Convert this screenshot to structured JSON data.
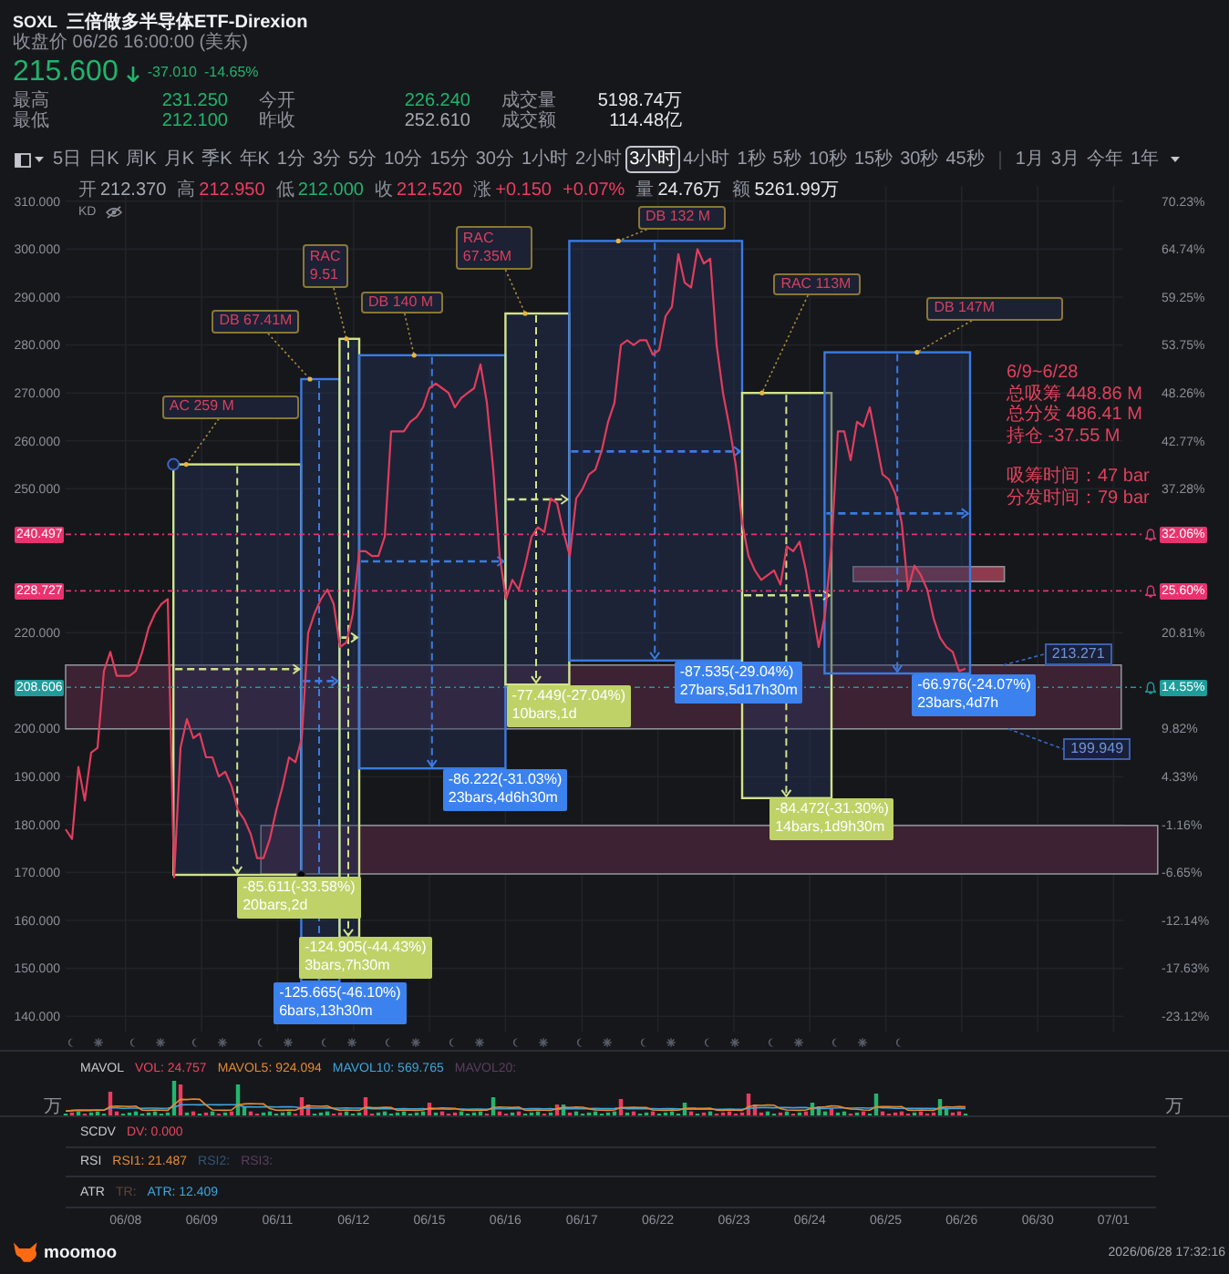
{
  "quote": {
    "symbol": "SOXL",
    "name": "三倍做多半导体ETF-Direxion",
    "close_time": "收盘价 06/26 16:00:00 (美东)",
    "price": "215.600",
    "change": "-37.010",
    "change_pct": "-14.65%",
    "falling": true
  },
  "stats": [
    {
      "label": "最高",
      "value": "231.250",
      "color": "#1fb46b"
    },
    {
      "label": "今开",
      "value": "226.240",
      "color": "#1fb46b"
    },
    {
      "label": "成交量",
      "value": "5198.74万",
      "color": "#e4e6ea"
    },
    {
      "label": "最低",
      "value": "212.100",
      "color": "#1fb46b"
    },
    {
      "label": "昨收",
      "value": "252.610",
      "color": "#a4a9b1"
    },
    {
      "label": "成交额",
      "value": "114.48亿",
      "color": "#e4e6ea"
    }
  ],
  "toolbar": {
    "periods": [
      {
        "label": "5日",
        "selected": false
      },
      {
        "label": "日K",
        "selected": false
      },
      {
        "label": "周K",
        "selected": false
      },
      {
        "label": "月K",
        "selected": false
      },
      {
        "label": "季K",
        "selected": false
      },
      {
        "label": "年K",
        "selected": false
      },
      {
        "label": "1分",
        "selected": false
      },
      {
        "label": "3分",
        "selected": false
      },
      {
        "label": "5分",
        "selected": false
      },
      {
        "label": "10分",
        "selected": false
      },
      {
        "label": "15分",
        "selected": false
      },
      {
        "label": "30分",
        "selected": false
      },
      {
        "label": "1小时",
        "selected": false
      },
      {
        "label": "2小时",
        "selected": false
      },
      {
        "label": "3小时",
        "selected": true
      },
      {
        "label": "4小时",
        "selected": false
      },
      {
        "label": "1秒",
        "selected": false
      },
      {
        "label": "5秒",
        "selected": false
      },
      {
        "label": "10秒",
        "selected": false
      },
      {
        "label": "15秒",
        "selected": false
      },
      {
        "label": "30秒",
        "selected": false
      },
      {
        "label": "45秒",
        "selected": false
      }
    ],
    "ranges": [
      {
        "label": "1月",
        "selected": false
      },
      {
        "label": "3月",
        "selected": false
      },
      {
        "label": "今年",
        "selected": false
      },
      {
        "label": "1年",
        "selected": false
      }
    ]
  },
  "chart": {
    "legend": [
      {
        "label": "开",
        "value": "212.370",
        "color": "#a4a9b1"
      },
      {
        "label": "高",
        "value": "212.950",
        "color": "#f03c60"
      },
      {
        "label": "低",
        "value": "212.000",
        "color": "#1fb46b"
      },
      {
        "label": "收",
        "value": "212.520",
        "color": "#f03c60"
      },
      {
        "label": "涨",
        "value": "+0.150",
        "color": "#f03c60"
      },
      {
        "value": "+0.07%",
        "color": "#f03c60"
      },
      {
        "label": "量",
        "value": "24.76万",
        "color": "#e4e6ea"
      },
      {
        "label": "额",
        "value": "5261.99万",
        "color": "#e4e6ea"
      }
    ],
    "overlay": {
      "label": "KD",
      "visible": false
    },
    "summary": [
      [
        "6/9~6/28",
        "总吸筹 448.86 M",
        "总分发 486.41 M",
        "持仓 -37.55 M"
      ],
      [
        "吸筹时间：47 bar",
        "分发时间：79 bar"
      ]
    ],
    "right_axis": [
      "70.23%",
      "64.74%",
      "59.25%",
      "53.75%",
      "48.26%",
      "42.77%",
      "37.28%",
      "20.81%",
      "9.82%",
      "4.33%",
      "-1.16%",
      "-6.65%",
      "-12.14%",
      "-17.63%",
      "-23.12%"
    ],
    "alert_tags": [
      {
        "text": "32.06%",
        "bell": true
      },
      {
        "text": "25.60%",
        "bell": true
      },
      {
        "text": "14.55%",
        "bell": true
      }
    ],
    "band_labels": [
      [
        "213.271",
        "199.949"
      ]
    ],
    "drawings": [
      {
        "kind": "accumulation",
        "selected": true,
        "tag": [
          "AC 259 M"
        ],
        "result": [
          "-85.611(-33.58%)",
          "20bars,2d"
        ]
      },
      {
        "kind": "distribution",
        "selected": false,
        "tag": [
          "DB 67.41M"
        ],
        "result": [
          "-125.665(-46.10%)",
          "6bars,13h30m"
        ]
      },
      {
        "kind": "accumulation",
        "selected": false,
        "tag": [
          "RAC",
          "9.51"
        ],
        "result": [
          "-124.905(-44.43%)",
          "3bars,7h30m"
        ]
      },
      {
        "kind": "distribution",
        "selected": false,
        "tag": [
          "DB 140 M"
        ],
        "result": [
          "-86.222(-31.03%)",
          "23bars,4d6h30m"
        ]
      },
      {
        "kind": "accumulation",
        "selected": false,
        "tag": [
          "RAC",
          "67.35M"
        ],
        "result": [
          "-77.449(-27.04%)",
          "10bars,1d"
        ]
      },
      {
        "kind": "distribution",
        "selected": false,
        "tag": [
          "DB 132 M"
        ],
        "result": [
          "-87.535(-29.04%)",
          "27bars,5d17h30m"
        ]
      },
      {
        "kind": "accumulation",
        "selected": false,
        "tag": [
          "RAC 113M"
        ],
        "result": [
          "-84.472(-31.30%)",
          "14bars,1d9h30m"
        ]
      },
      {
        "kind": "distribution",
        "selected": false,
        "tag": [
          "DB 147M"
        ],
        "result": [
          "-66.976(-24.07%)",
          "23bars,4d7h"
        ]
      }
    ],
    "chart_data": {
      "type": "line",
      "grid": true,
      "ylim": [
        136.8,
        313.2
      ],
      "categories": [
        null,
        null,
        null,
        null,
        null,
        null,
        null,
        null,
        null,
        null,
        null,
        null,
        null,
        null,
        null,
        null,
        null,
        null,
        null,
        null,
        null,
        null,
        null,
        null,
        null,
        null,
        null,
        null,
        null,
        null,
        null,
        null,
        null,
        null,
        null,
        null,
        null,
        null,
        null,
        null,
        null,
        null,
        null,
        null,
        null,
        null,
        null,
        null,
        null,
        null,
        null,
        null,
        null,
        null,
        null,
        null,
        null,
        null,
        null,
        null,
        null,
        null,
        null,
        null,
        null,
        null,
        null,
        null,
        null,
        null,
        null,
        null,
        null,
        null,
        null,
        null,
        null,
        null,
        null,
        null,
        null,
        null,
        null,
        null,
        null,
        null,
        null,
        null,
        null,
        null,
        null,
        null,
        null,
        null,
        null,
        null,
        null,
        null,
        null,
        null,
        null,
        null,
        null,
        null,
        null,
        null,
        null,
        null,
        null,
        null,
        null,
        null,
        null,
        null,
        null,
        null,
        null,
        null,
        null,
        null,
        null,
        null,
        null,
        null,
        null,
        null,
        null,
        null,
        null,
        null,
        null,
        null,
        null,
        null,
        null,
        null,
        null,
        null,
        null,
        null,
        null,
        null,
        null,
        null,
        null,
        null,
        null,
        null,
        null,
        null,
        null,
        null,
        null,
        null,
        null,
        null,
        null,
        null,
        null,
        null,
        null,
        null,
        null,
        null,
        null
      ],
      "yticks": [
        {
          "value": 310,
          "label": "310.000"
        },
        {
          "value": 300,
          "label": "300.000"
        },
        {
          "value": 290,
          "label": "290.000"
        },
        {
          "value": 280,
          "label": "280.000"
        },
        {
          "value": 270,
          "label": "270.000"
        },
        {
          "value": 260,
          "label": "260.000"
        },
        {
          "value": 250,
          "label": "250.000"
        },
        {
          "value": 220,
          "label": "220.000"
        },
        {
          "value": 200,
          "label": "200.000"
        },
        {
          "value": 190,
          "label": "190.000"
        },
        {
          "value": 180,
          "label": "180.000"
        },
        {
          "value": 170,
          "label": "170.000"
        },
        {
          "value": 160,
          "label": "160.000"
        },
        {
          "value": 150,
          "label": "150.000"
        },
        {
          "value": 140,
          "label": "140.000"
        }
      ],
      "series": [
        {
          "color": "#e23c5d",
          "values": [
            179,
            177,
            192,
            185,
            195,
            196,
            212,
            216,
            211,
            211,
            211,
            212,
            216,
            221,
            224,
            226,
            227,
            169,
            196,
            202,
            198,
            199,
            194,
            194,
            190,
            191,
            188,
            183,
            181,
            178,
            173,
            173,
            177,
            183,
            188,
            194,
            193,
            198,
            220,
            224,
            227,
            229,
            226,
            217,
            218,
            224,
            237,
            237,
            236,
            236,
            240,
            262,
            262,
            262,
            264,
            265,
            267,
            271,
            272,
            271,
            270,
            267,
            269,
            270,
            271,
            276,
            268,
            254,
            236,
            227,
            231,
            229,
            234,
            240,
            242,
            241,
            248,
            247,
            241,
            236,
            248,
            250,
            253,
            254,
            258,
            264,
            268,
            280,
            281,
            280,
            281,
            281,
            278,
            279,
            286,
            288,
            299,
            293,
            292,
            300,
            297,
            298,
            280,
            270,
            263,
            255,
            243,
            236,
            233,
            231,
            232,
            233,
            230,
            238,
            237,
            239,
            233,
            225,
            217,
            224,
            238,
            262,
            262,
            256,
            264,
            263,
            267,
            260,
            253,
            252,
            249,
            243,
            229,
            234,
            232,
            229,
            223,
            219,
            217,
            216,
            212,
            212.5,
            null,
            null,
            null,
            null,
            null,
            null,
            null,
            null,
            null,
            null,
            null,
            null,
            null,
            null,
            null,
            null,
            null,
            null,
            null,
            null,
            null,
            null,
            null
          ]
        }
      ],
      "ref_lines": [
        {
          "axis": "y",
          "value": 240.497,
          "label": "240.497",
          "color": "#e8336e"
        },
        {
          "axis": "y",
          "value": 228.727,
          "label": "228.727",
          "color": "#e8336e"
        },
        {
          "axis": "y",
          "value": 208.606,
          "label": "208.606",
          "color": "#1f9c9a"
        }
      ],
      "bands": [
        {
          "axis": "y",
          "from": 199.949,
          "to": 213.271,
          "color": "#3c2232"
        },
        {
          "axis": "y",
          "from": 169.7,
          "to": 179.8,
          "color": "#3c2232"
        },
        {
          "axis": "y",
          "from": 230.7,
          "to": 233.8,
          "color": "#8e3b4e"
        }
      ]
    }
  },
  "indicators": [
    {
      "kind": "volume",
      "name": "MAVOL",
      "values": [
        {
          "text": "VOL: 24.757",
          "color": "#e8455f"
        },
        {
          "text": "MAVOL5: 924.094",
          "color": "#e58a32"
        },
        {
          "text": "MAVOL10: 569.765",
          "color": "#3ea6dc"
        },
        {
          "text": "MAVOL20:",
          "color": "#5b3f5e"
        }
      ],
      "units": [
        "万",
        "万"
      ]
    },
    {
      "kind": "line",
      "name": "SCDV",
      "values": [
        {
          "text": "DV: 0.000",
          "color": "#e8455f"
        }
      ]
    },
    {
      "kind": "line",
      "name": "RSI",
      "values": [
        {
          "text": "RSI1: 21.487",
          "color": "#e58a32"
        },
        {
          "text": "RSI2:",
          "color": "#2c5878"
        },
        {
          "text": "RSI3:",
          "color": "#5b3f5e"
        }
      ]
    },
    {
      "kind": "line",
      "name": "ATR",
      "values": [
        {
          "text": "TR:",
          "color": "#5f4636"
        },
        {
          "text": "ATR: 12.409",
          "color": "#3ea6dc"
        }
      ]
    }
  ],
  "date_axis": [
    "06/08",
    "06/09",
    "06/11",
    "06/12",
    "06/15",
    "06/16",
    "06/17",
    "06/22",
    "06/23",
    "06/24",
    "06/25",
    "06/26",
    "06/30",
    "07/01"
  ],
  "footer": {
    "brand": "moomoo",
    "timestamp": "2026/06/28 17:32:16"
  }
}
